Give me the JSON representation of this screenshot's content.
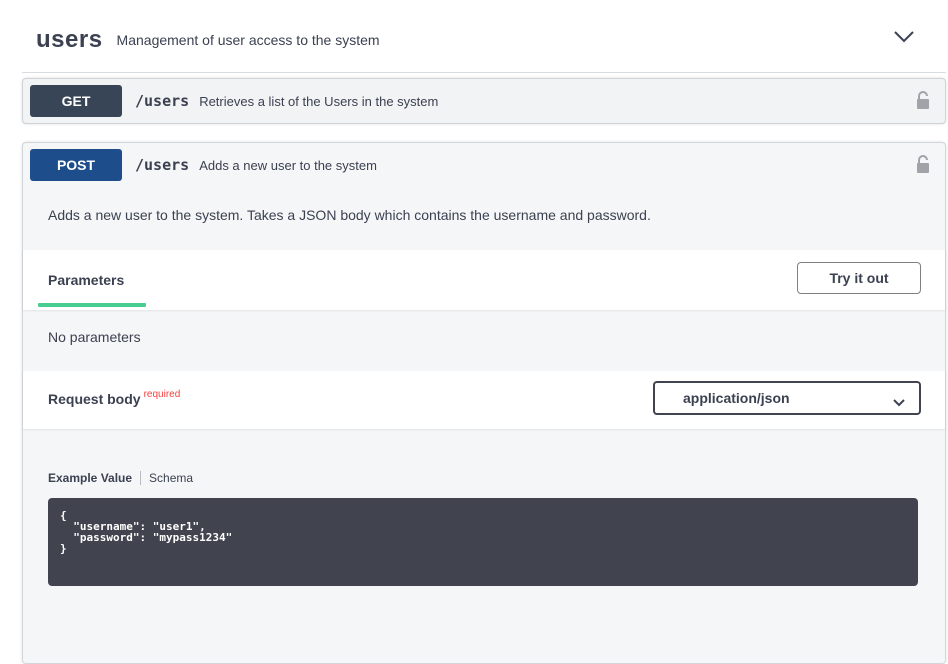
{
  "tag": {
    "name": "users",
    "description": "Management of user access to the system",
    "chevron_icon": "chevron-down-icon"
  },
  "operations": {
    "get": {
      "method": "GET",
      "path": "/users",
      "summary": "Retrieves a list of the Users in the system",
      "method_color": "#374556",
      "lock_icon": "lock-icon"
    },
    "post": {
      "method": "POST",
      "path": "/users",
      "summary": "Adds a new user to the system",
      "method_color": "#1e4d8c",
      "lock_icon": "lock-icon",
      "description": "Adds a new user to the system. Takes a JSON body which contains the username and password.",
      "parameters": {
        "title": "Parameters",
        "try_button": "Try it out",
        "empty_text": "No parameters",
        "tab_underline_color": "#49cc90"
      },
      "request_body": {
        "title": "Request body",
        "required_label": "required",
        "content_type": "application/json",
        "tabs": [
          "Example Value",
          "Schema"
        ],
        "example": "{\n  \"username\": \"user1\",\n  \"password\": \"mypass1234\"\n}"
      }
    }
  }
}
